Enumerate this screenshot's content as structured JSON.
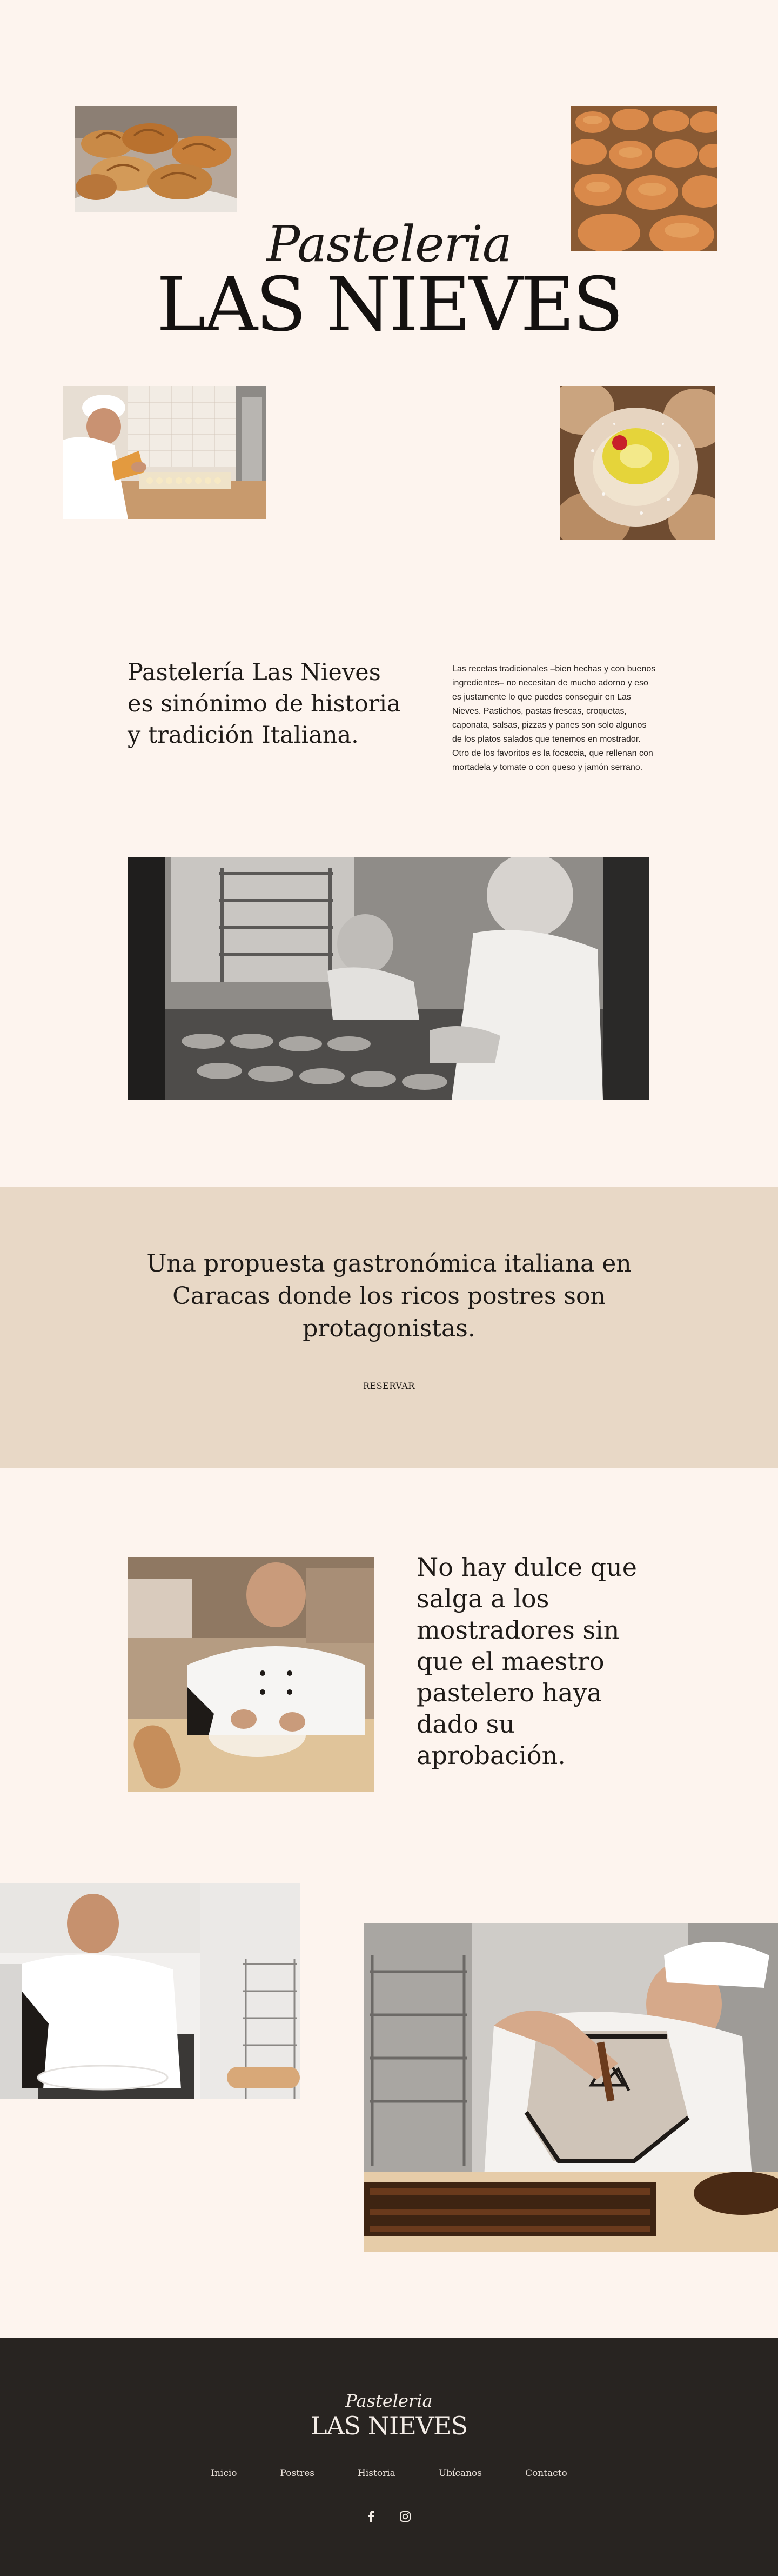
{
  "hero": {
    "script_title": "Pasteleria",
    "main_title": "LAS NIEVES"
  },
  "intro": {
    "heading": "Pastelería Las Nieves es sinónimo de historia y tradición Italiana.",
    "body": "Las recetas tradicionales –bien hechas y con buenos ingredientes– no necesitan de mucho adorno y eso es justamente lo que puedes conseguir en Las Nieves. Pastichos, pastas frescas, croquetas, caponata, salsas, pizzas y panes son solo algunos de los platos salados que tenemos en mostrador. Otro de los favoritos es la focaccia, que rellenan con mortadela y tomate o con queso y jamón serrano."
  },
  "band": {
    "text": "Una propuesta gastronómica italiana en Caracas donde los ricos postres son protagonistas.",
    "button_label": "RESERVAR"
  },
  "quote": {
    "text": "No hay dulce que salga a los mostradores sin que el maestro pastelero haya dado su aprobación."
  },
  "footer": {
    "script_title": "Pasteleria",
    "main_title": "LAS NIEVES",
    "nav": [
      "Inicio",
      "Postres",
      "Historia",
      "Ubícanos",
      "Contacto"
    ],
    "social": [
      "facebook-icon",
      "instagram-icon"
    ]
  },
  "colors": {
    "page_bg": "#fdf4ee",
    "band_bg": "#e8d8c6",
    "footer_bg": "#282421",
    "text": "#1e1a17"
  }
}
